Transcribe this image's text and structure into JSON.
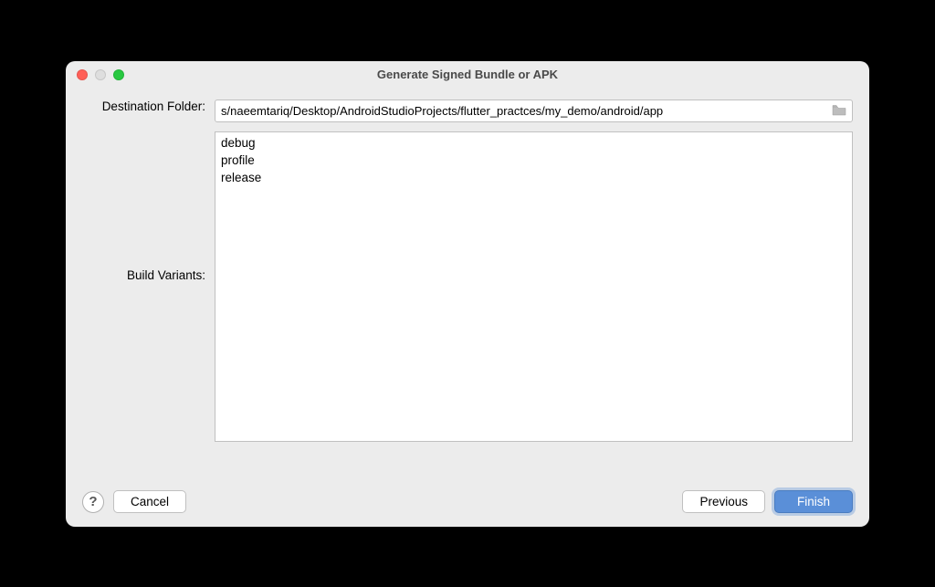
{
  "window": {
    "title": "Generate Signed Bundle or APK"
  },
  "labels": {
    "destination_folder": "Destination Folder:",
    "build_variants": "Build Variants:"
  },
  "destination": {
    "path": "s/naeemtariq/Desktop/AndroidStudioProjects/flutter_practces/my_demo/android/app"
  },
  "variants": [
    "debug",
    "profile",
    "release"
  ],
  "buttons": {
    "help": "?",
    "cancel": "Cancel",
    "previous": "Previous",
    "finish": "Finish"
  }
}
